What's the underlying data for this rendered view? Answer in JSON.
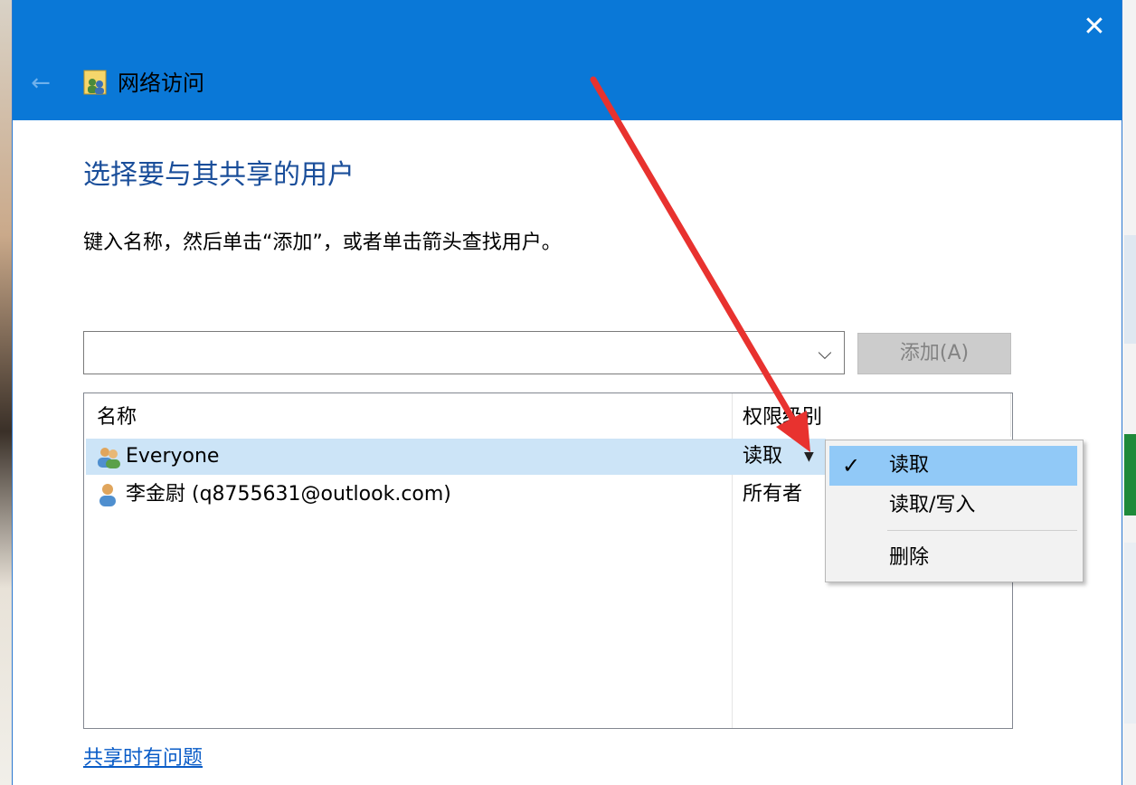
{
  "window": {
    "title": "网络访问",
    "close_label": "✕",
    "back_label": "←"
  },
  "main": {
    "heading": "选择要与其共享的用户",
    "instructions": "键入名称，然后单击“添加”，或者单击箭头查找用户。",
    "combo_value": "",
    "combo_arrow": "⌵",
    "add_button_label": "添加(A)"
  },
  "list": {
    "columns": [
      "名称",
      "权限级别"
    ],
    "rows": [
      {
        "name": "Everyone",
        "permission": "读取",
        "selected": true,
        "icon": "users-group-icon"
      },
      {
        "name": "李金尉 (q8755631@outlook.com)",
        "permission": "所有者",
        "selected": false,
        "icon": "user-icon"
      }
    ],
    "perm_dropdown_glyph": "▼"
  },
  "permission_menu": {
    "items": [
      {
        "label": "读取",
        "checked": true,
        "highlighted": true
      },
      {
        "label": "读取/写入",
        "checked": false,
        "highlighted": false
      },
      {
        "label": "删除",
        "checked": false,
        "highlighted": false
      }
    ],
    "check_glyph": "✓"
  },
  "footer": {
    "help_link": "共享时有问题"
  },
  "colors": {
    "titlebar": "#0a78d7",
    "heading": "#1a4e9a",
    "selection": "#cce4f7",
    "menu_highlight": "#91c9f7",
    "link": "#0a5cc7",
    "annotation_arrow": "#e8322f"
  }
}
